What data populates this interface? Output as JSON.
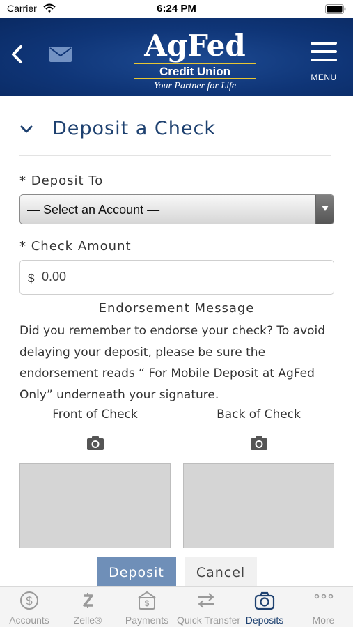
{
  "status": {
    "carrier": "Carrier",
    "time": "6:24 PM"
  },
  "header": {
    "logo": {
      "line1": "AgFed",
      "line2": "Credit Union",
      "tagline": "Your Partner for Life"
    },
    "menu_label": "MENU"
  },
  "page": {
    "title": "Deposit a Check",
    "deposit_to_label": "* Deposit To",
    "account_select_value": "— Select an Account —",
    "check_amount_label": "* Check Amount",
    "currency_symbol": "$",
    "amount_value": "0.00",
    "endorsement_title": "Endorsement Message",
    "endorsement_text": "Did you remember to endorse your check? To avoid delaying your deposit, please be sure the endorsement reads “ For Mobile Deposit at AgFed Only” underneath your signature.",
    "front_label": "Front of Check",
    "back_label": "Back of Check",
    "deposit_button": "Deposit",
    "cancel_button": "Cancel"
  },
  "tabs": [
    {
      "label": "Accounts",
      "icon": "dollar-circle-icon"
    },
    {
      "label": "Zelle®",
      "icon": "zelle-icon"
    },
    {
      "label": "Payments",
      "icon": "payments-icon"
    },
    {
      "label": "Quick Transfer",
      "icon": "transfer-arrows-icon"
    },
    {
      "label": "Deposits",
      "icon": "camera-icon",
      "active": true
    },
    {
      "label": "More",
      "icon": "more-dots-icon"
    }
  ],
  "colors": {
    "header_blue": "#0f3577",
    "title_blue": "#1e4170",
    "logo_gold": "#e7c634",
    "deposit_button": "#6f8fb8"
  }
}
